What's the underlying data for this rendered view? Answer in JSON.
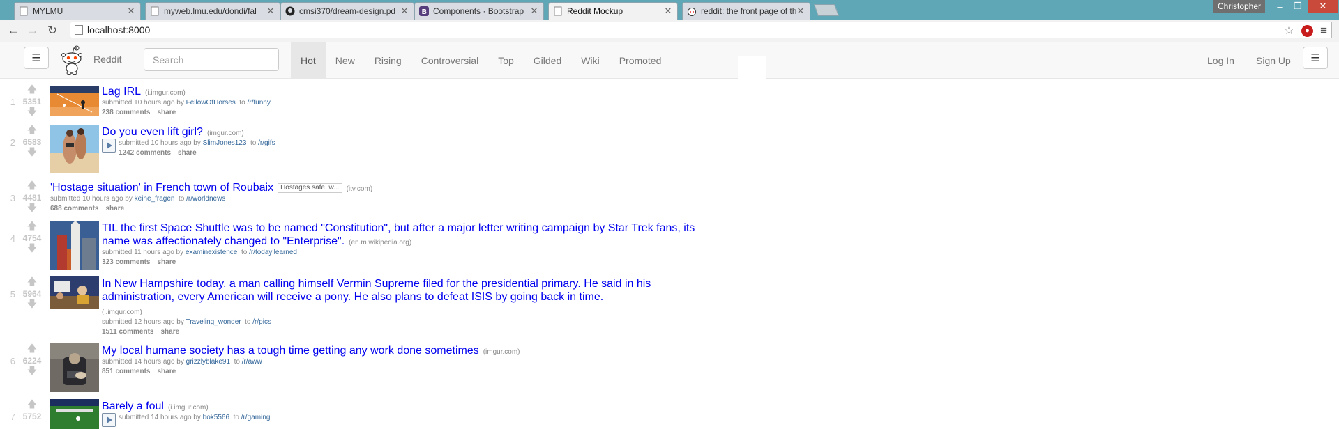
{
  "browser": {
    "tabs": [
      {
        "title": "MYLMU",
        "icon": "page-icon"
      },
      {
        "title": "myweb.lmu.edu/dondi/fal",
        "icon": "page-icon"
      },
      {
        "title": "cmsi370/dream-design.pd",
        "icon": "github-icon"
      },
      {
        "title": "Components · Bootstrap",
        "icon": "bootstrap-icon"
      },
      {
        "title": "Reddit Mockup",
        "icon": "page-icon",
        "active": true
      },
      {
        "title": "reddit: the front page of th",
        "icon": "reddit-icon"
      }
    ],
    "user": "Christopher",
    "url": "localhost:8000"
  },
  "navbar": {
    "brand": "Reddit",
    "search_placeholder": "Search",
    "tabs": [
      "Hot",
      "New",
      "Rising",
      "Controversial",
      "Top",
      "Gilded",
      "Wiki",
      "Promoted"
    ],
    "active_tab": "Hot",
    "login": "Log In",
    "signup": "Sign Up"
  },
  "posts": [
    {
      "rank": "1",
      "score": "5351",
      "title": "Lag IRL",
      "domain": "(i.imgur.com)",
      "submitted": "submitted 10 hours ago by",
      "author": "FellowOfHorses",
      "to": "to",
      "subreddit": "/r/funny",
      "comments": "238 comments",
      "share": "share"
    },
    {
      "rank": "2",
      "score": "6583",
      "title": "Do you even lift girl?",
      "domain": "(imgur.com)",
      "submitted": "submitted 10 hours ago by",
      "author": "SlimJones123",
      "to": "to",
      "subreddit": "/r/gifs",
      "comments": "1242 comments",
      "share": "share"
    },
    {
      "rank": "3",
      "score": "4481",
      "title": "'Hostage situation' in French town of Roubaix",
      "flair": "Hostages safe, w...",
      "domain": "(itv.com)",
      "submitted": "submitted 10 hours ago by",
      "author": "keine_fragen",
      "to": "to",
      "subreddit": "/r/worldnews",
      "comments": "688 comments",
      "share": "share"
    },
    {
      "rank": "4",
      "score": "4754",
      "title": "TIL the first Space Shuttle was to be named \"Constitution\", but after a major letter writing campaign by Star Trek fans, its name was affectionately changed to \"Enterprise\".",
      "domain": "(en.m.wikipedia.org)",
      "submitted": "submitted 11 hours ago by",
      "author": "examinexistence",
      "to": "to",
      "subreddit": "/r/todayilearned",
      "comments": "323 comments",
      "share": "share"
    },
    {
      "rank": "5",
      "score": "5964",
      "title": "In New Hampshire today, a man calling himself Vermin Supreme filed for the presidential primary. He said in his administration, every American will receive a pony. He also plans to defeat ISIS by going back in time.",
      "domain": "(i.imgur.com)",
      "submitted": "submitted 12 hours ago by",
      "author": "Traveling_wonder",
      "to": "to",
      "subreddit": "/r/pics",
      "comments": "1511 comments",
      "share": "share"
    },
    {
      "rank": "6",
      "score": "6224",
      "title": "My local humane society has a tough time getting any work done sometimes",
      "domain": "(imgur.com)",
      "submitted": "submitted 14 hours ago by",
      "author": "grizzlyblake91",
      "to": "to",
      "subreddit": "/r/aww",
      "comments": "851 comments",
      "share": "share"
    },
    {
      "rank": "7",
      "score": "5752",
      "title": "Barely a foul",
      "domain": "(i.imgur.com)",
      "submitted": "submitted 14 hours ago by",
      "author": "bok5566",
      "to": "to",
      "subreddit": "/r/gaming",
      "comments": "",
      "share": ""
    }
  ]
}
